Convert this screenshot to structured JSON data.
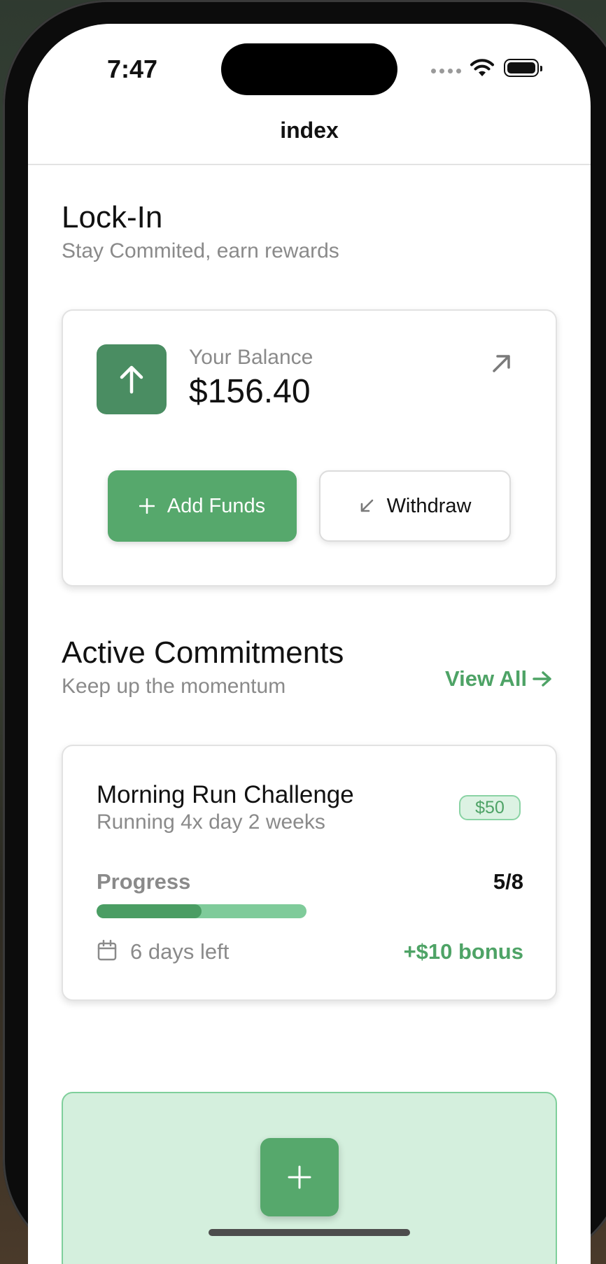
{
  "status_bar": {
    "time": "7:47"
  },
  "nav": {
    "title": "index"
  },
  "header": {
    "title": "Lock-In",
    "subtitle": "Stay Commited, earn rewards"
  },
  "balance": {
    "label": "Your Balance",
    "value": "$156.40",
    "add_funds_label": "Add Funds",
    "withdraw_label": "Withdraw"
  },
  "commitments": {
    "title": "Active Commitments",
    "subtitle": "Keep up the momentum",
    "view_all_label": "View All",
    "items": [
      {
        "title": "Morning Run Challenge",
        "subtitle": "Running 4x day 2 weeks",
        "amount": "$50",
        "progress_label": "Progress",
        "progress_text": "5/8",
        "progress_fraction": 0.5,
        "days_left": "6 days left",
        "bonus": "+$10 bonus"
      }
    ]
  },
  "colors": {
    "accent": "#56a86c",
    "accent_dark": "#4a8d62",
    "accent_light": "#d4efdd",
    "muted_text": "#8a8a8a"
  },
  "icons": {
    "balance": "arrow-up-icon",
    "expand": "arrow-up-right-icon",
    "add": "plus-icon",
    "withdraw": "arrow-down-left-icon",
    "view_all": "arrow-right-icon",
    "calendar": "calendar-icon",
    "fab": "plus-icon"
  }
}
